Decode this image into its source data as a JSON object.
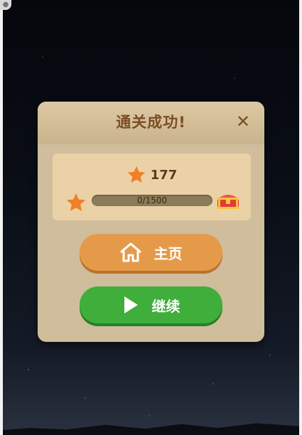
{
  "dialog": {
    "title": "通关成功!",
    "close_glyph": "✕"
  },
  "score": {
    "value": "177",
    "icon": "star-icon"
  },
  "progress": {
    "text": "0/1500",
    "current": 0,
    "max": 1500,
    "reward_icon": "treasure-chest-icon"
  },
  "buttons": {
    "home_label": "主页",
    "home_icon": "home-icon",
    "continue_label": "继续",
    "continue_icon": "play-icon"
  },
  "colors": {
    "title": "#7a4e24",
    "home_button": "#e59a4a",
    "continue_button": "#3fae3a",
    "star": "#f07f2a"
  }
}
